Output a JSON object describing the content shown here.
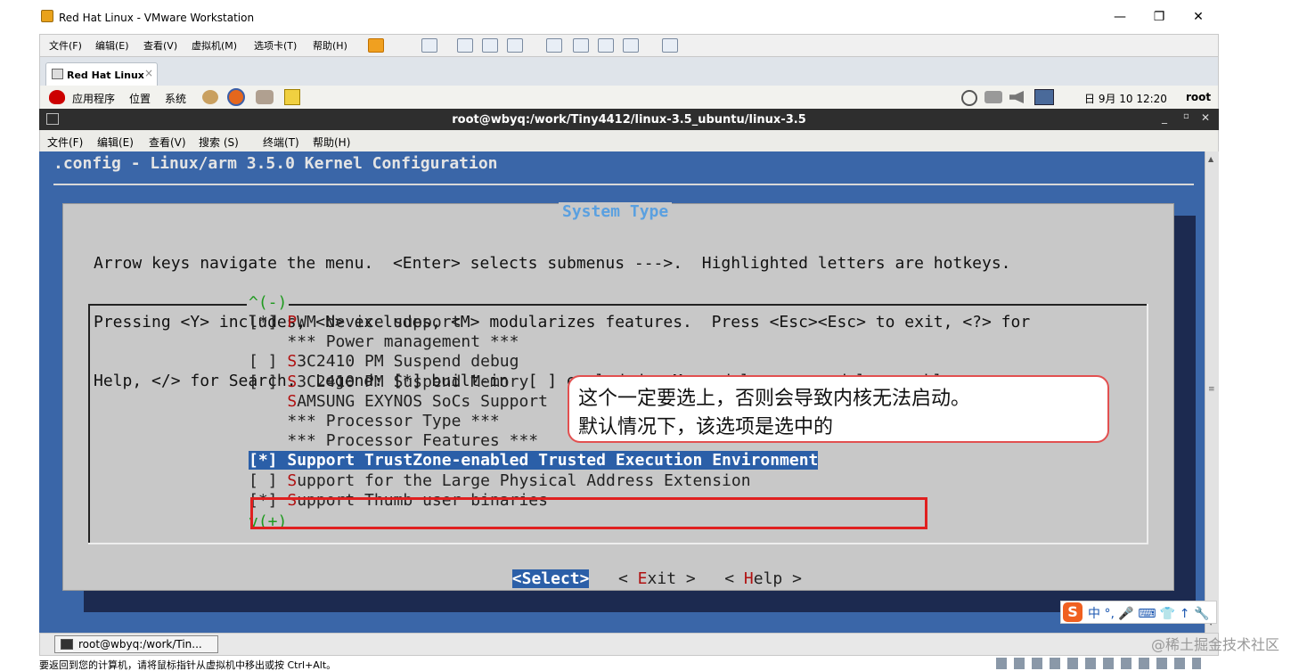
{
  "window": {
    "title": "Red Hat Linux - VMware Workstation"
  },
  "menubar": [
    "文件(F)",
    "编辑(E)",
    "查看(V)",
    "虚拟机(M)",
    "选项卡(T)",
    "帮助(H)"
  ],
  "tab": {
    "label": "Red Hat Linux",
    "close": "×"
  },
  "gnome": {
    "apps": "应用程序",
    "places": "位置",
    "system": "系统",
    "datetime": "日 9月 10 12:20",
    "user": "root"
  },
  "terminal": {
    "title": "root@wbyq:/work/Tiny4412/linux-3.5_ubuntu/linux-3.5",
    "menu": [
      "文件(F)",
      "编辑(E)",
      "查看(V)",
      "搜索 (S)",
      "终端(T)",
      "帮助(H)"
    ]
  },
  "config": {
    "title": ".config - Linux/arm 3.5.0 Kernel Configuration",
    "dialog_title": "System Type",
    "help_lines": [
      "Arrow keys navigate the menu.  <Enter> selects submenus --->.  Highlighted letters are hotkeys.",
      "Pressing <Y> includes, <N> excludes, <M> modularizes features.  Press <Esc><Esc> to exit, <?> for",
      "Help, </> for Search.  Legend: [*] built-in  [ ] excluded  <M> module  < > module capable"
    ],
    "scroll_up": "^(-)",
    "scroll_down": "v(+)",
    "items": [
      {
        "prefix": "[*] ",
        "hotkey": "P",
        "rest": "WM device support"
      },
      {
        "prefix": "    ",
        "hotkey": "",
        "rest": "*** Power management ***"
      },
      {
        "prefix": "[ ] ",
        "hotkey": "S",
        "rest": "3C2410 PM Suspend debug"
      },
      {
        "prefix": "[ ] ",
        "hotkey": "S",
        "rest": "3C2410 PM Suspend Memory"
      },
      {
        "prefix": "    ",
        "hotkey": "S",
        "rest": "AMSUNG EXYNOS SoCs Support  --->"
      },
      {
        "prefix": "    ",
        "hotkey": "",
        "rest": "*** Processor Type ***"
      },
      {
        "prefix": "    ",
        "hotkey": "",
        "rest": "*** Processor Features ***"
      },
      {
        "prefix": "[*] ",
        "hotkey": "S",
        "rest": "upport TrustZone-enabled Trusted Execution Environment"
      },
      {
        "prefix": "[ ] ",
        "hotkey": "S",
        "rest": "upport for the Large Physical Address Extension"
      },
      {
        "prefix": "[*] ",
        "hotkey": "S",
        "rest": "upport Thumb user binaries"
      }
    ],
    "selected_index": 7,
    "buttons": {
      "select": "<Select>",
      "exit_l": "< ",
      "exit_h": "E",
      "exit_r": "xit >",
      "help_l": "< ",
      "help_h": "H",
      "help_r": "elp >"
    }
  },
  "callout": {
    "line1": "这个一定要选上，否则会导致内核无法启动。",
    "line2": "默认情况下，该选项是选中的"
  },
  "ime": {
    "logo": "S",
    "text": "中 °, 🎤 ⌨ 👕 ↑ 🔧"
  },
  "taskbar": {
    "item": "root@wbyq:/work/Tin..."
  },
  "statusbar": {
    "hint": "要返回到您的计算机，请将鼠标指针从虚拟机中移出或按 Ctrl+Alt。"
  },
  "watermark": "@稀土掘金技术社区",
  "colors": {
    "screen": "#3a66a8",
    "dialog": "#c8c8c8",
    "highlight": "#2b5fa8",
    "hotkey": "#b01010",
    "annotation": "#e02020"
  }
}
